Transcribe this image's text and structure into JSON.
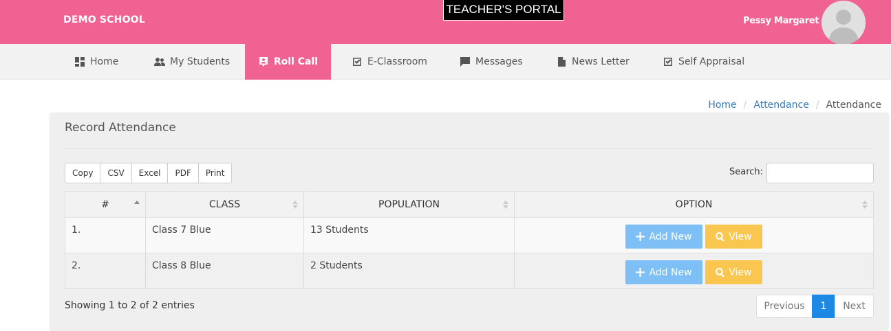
{
  "header": {
    "brand": "DEMO SCHOOL",
    "portal_title": "TEACHER'S PORTAL",
    "user_name": "Pessy Margaret",
    "colors": {
      "primary": "#f06292",
      "black": "#000000"
    }
  },
  "nav": {
    "items": [
      {
        "label": "Home",
        "icon": "dashboard-icon"
      },
      {
        "label": "My Students",
        "icon": "people-icon"
      },
      {
        "label": "Roll Call",
        "icon": "roll-call-icon",
        "active": true
      },
      {
        "label": "E-Classroom",
        "icon": "checkbox-icon"
      },
      {
        "label": "Messages",
        "icon": "message-icon"
      },
      {
        "label": "News Letter",
        "icon": "document-icon"
      },
      {
        "label": "Self Appraisal",
        "icon": "checkbox-icon"
      }
    ]
  },
  "breadcrumb": [
    "Home",
    "Attendance",
    "Attendance"
  ],
  "panel": {
    "title": "Record Attendance",
    "export_buttons": [
      "Copy",
      "CSV",
      "Excel",
      "PDF",
      "Print"
    ],
    "search_label": "Search:",
    "search_value": ""
  },
  "table": {
    "columns": [
      "#",
      "CLASS",
      "POPULATION",
      "OPTION"
    ],
    "rows": [
      {
        "num": "1.",
        "class": "Class 7 Blue",
        "population": "13 Students"
      },
      {
        "num": "2.",
        "class": "Class 8 Blue",
        "population": "2 Students"
      }
    ],
    "add_label": "Add New",
    "view_label": "View",
    "colors": {
      "add": "#7ec0f5",
      "view": "#f9c74f"
    }
  },
  "footer": {
    "info": "Showing 1 to 2 of 2 entries",
    "previous": "Previous",
    "page": "1",
    "next": "Next"
  }
}
